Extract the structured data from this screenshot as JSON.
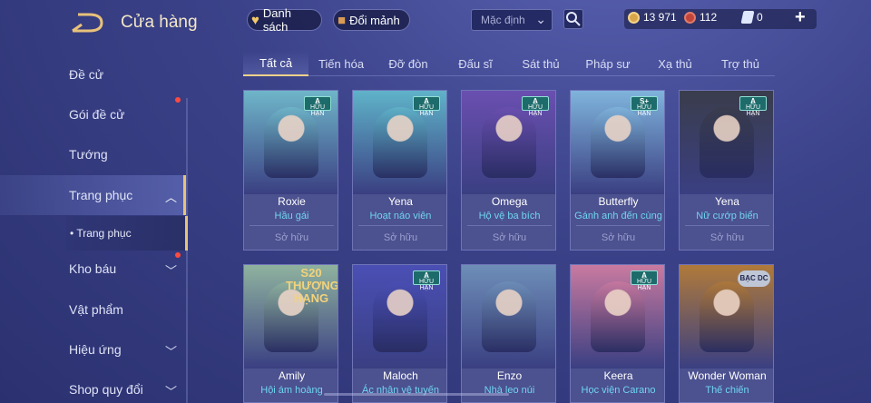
{
  "header": {
    "title": "Cửa hàng",
    "wishlist_label": "Danh sách",
    "exchange_label": "Đổi mảnh",
    "sort_selected": "Mặc định",
    "currency": {
      "gold": "13 971",
      "ruby": "112",
      "vouchers": "0"
    },
    "icons": {
      "back": "back-arrow-icon",
      "search": "search-icon",
      "add": "plus-icon"
    }
  },
  "sidebar": {
    "items": [
      {
        "label": "Đề cử"
      },
      {
        "label": "Gói đề cử"
      },
      {
        "label": "Tướng"
      },
      {
        "label": "Trang phục"
      },
      {
        "label": "Kho báu"
      },
      {
        "label": "Vật phẩm"
      },
      {
        "label": "Hiệu ứng"
      },
      {
        "label": "Shop quy đổi"
      }
    ],
    "sub_item": "• Trang phục"
  },
  "tabs": [
    "Tất cả",
    "Tiến hóa",
    "Đỡ đòn",
    "Đấu sĩ",
    "Sát thủ",
    "Pháp sư",
    "Xạ thủ",
    "Trợ thủ"
  ],
  "cards": [
    {
      "name": "Roxie",
      "skin": "Hầu gái",
      "status": "Sở hữu",
      "badge_grade": "A",
      "badge_text": "HỮU HẠN",
      "color": "#6fb6c9"
    },
    {
      "name": "Yena",
      "skin": "Hoạt náo viên",
      "status": "Sở hữu",
      "badge_grade": "A",
      "badge_text": "HỮU HẠN",
      "color": "#5fb3c9"
    },
    {
      "name": "Omega",
      "skin": "Hộ vệ ba bích",
      "status": "Sở hữu",
      "badge_grade": "A",
      "badge_text": "HỮU HẠN",
      "color": "#6a4fb0"
    },
    {
      "name": "Butterfly",
      "skin": "Gánh anh đến cùng",
      "status": "Sở hữu",
      "badge_grade": "S+",
      "badge_text": "HỮU HẠN",
      "color": "#7fb4dc"
    },
    {
      "name": "Yena",
      "skin": "Nữ cướp biển",
      "status": "Sở hữu",
      "badge_grade": "A",
      "badge_text": "HỮU HẠN",
      "color": "#3a3d4c"
    },
    {
      "name": "Amily",
      "skin": "Hội ám hoàng",
      "status": "",
      "badge_text": "S20 THƯỢNG HẠNG",
      "color": "#8fb39f"
    },
    {
      "name": "Maloch",
      "skin": "Ác nhân vệ tuyến",
      "status": "",
      "badge_grade": "A",
      "badge_text": "HỮU HẠN",
      "color": "#4a4fb4"
    },
    {
      "name": "Enzo",
      "skin": "Nhà leo núi",
      "status": "",
      "badge_text": "",
      "color": "#6e8eb8"
    },
    {
      "name": "Keera",
      "skin": "Học viện Carano",
      "status": "",
      "badge_grade": "A",
      "badge_text": "HỮU HẠN",
      "color": "#c97aa0"
    },
    {
      "name": "Wonder Woman",
      "skin": "Thế chiến",
      "status": "",
      "badge_text": "BẠC DC",
      "color": "#b07a3a"
    }
  ]
}
